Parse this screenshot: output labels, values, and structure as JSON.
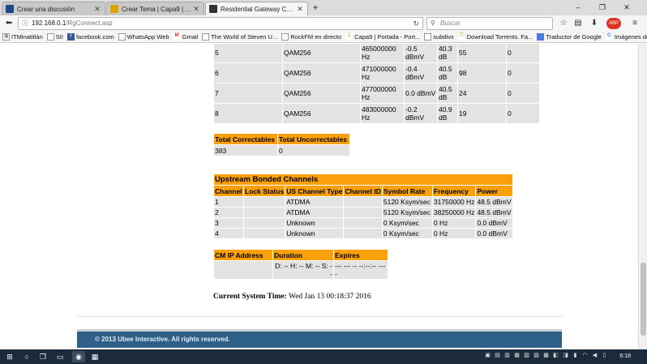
{
  "browser": {
    "tabs": [
      {
        "label": "Crear una discusión",
        "favicon_color": "#1a4a8a",
        "active": false
      },
      {
        "label": "Crear Tema | Capa9 | El Po...",
        "favicon_color": "#d9a400",
        "active": false
      },
      {
        "label": "Residential Gateway Confi...",
        "favicon_color": "#333333",
        "active": true
      }
    ],
    "new_tab": "+",
    "window_controls": {
      "minimize": "–",
      "maximize": "❐",
      "close": "✕"
    },
    "url_host": "192.168.0.1",
    "url_path": "/RgConnect.asp",
    "search_placeholder": "Buscar",
    "bookmarks": [
      {
        "label": "ITMinatitlán",
        "icon": "globe-icon"
      },
      {
        "label": "SII",
        "icon": "page-icon"
      },
      {
        "label": "facebook.com",
        "icon": "facebook-icon"
      },
      {
        "label": "WhatsApp Web",
        "icon": "page-icon"
      },
      {
        "label": "Gmail",
        "icon": "gmail-icon"
      },
      {
        "label": "The World of Steven U...",
        "icon": "page-icon"
      },
      {
        "label": "RockFM en directo",
        "icon": "page-icon"
      },
      {
        "label": "Capa9 | Portada - Port...",
        "icon": "capa9-icon"
      },
      {
        "label": "subdivx",
        "icon": "page-icon"
      },
      {
        "label": "Download Torrents. Fa...",
        "icon": "shield-icon"
      },
      {
        "label": "Traductor de Google",
        "icon": "translate-icon"
      },
      {
        "label": "Imágenes de Google",
        "icon": "google-icon"
      }
    ],
    "addon_badge": "ABP"
  },
  "downstream_rows": [
    {
      "channel": "5",
      "modulation": "QAM256",
      "frequency": "465000000 Hz",
      "power": "-0.5 dBmV",
      "snr": "40.3 dB",
      "correctables": "55",
      "uncorrectables": "0"
    },
    {
      "channel": "6",
      "modulation": "QAM256",
      "frequency": "471000000 Hz",
      "power": "-0.4 dBmV",
      "snr": "40.5 dB",
      "correctables": "98",
      "uncorrectables": "0"
    },
    {
      "channel": "7",
      "modulation": "QAM256",
      "frequency": "477000000 Hz",
      "power": "0.0 dBmV",
      "snr": "40.5 dB",
      "correctables": "24",
      "uncorrectables": "0"
    },
    {
      "channel": "8",
      "modulation": "QAM256",
      "frequency": "483000000 Hz",
      "power": "-0.2 dBmV",
      "snr": "40.9 dB",
      "correctables": "19",
      "uncorrectables": "0"
    }
  ],
  "errors": {
    "headers": [
      "Total Correctables",
      "Total Uncorrectables"
    ],
    "values": [
      "383",
      "0"
    ]
  },
  "upstream": {
    "title": "Upstream Bonded Channels",
    "headers": [
      "Channel",
      "Lock Status",
      "US Channel Type",
      "Channel ID",
      "Symbol Rate",
      "Frequency",
      "Power"
    ],
    "rows": [
      {
        "channel": "1",
        "lock": "",
        "type": "ATDMA",
        "id": "",
        "symbol_rate": "5120 Ksym/sec",
        "frequency": "31750000 Hz",
        "power": "48.5 dBmV"
      },
      {
        "channel": "2",
        "lock": "",
        "type": "ATDMA",
        "id": "",
        "symbol_rate": "5120 Ksym/sec",
        "frequency": "38250000 Hz",
        "power": "48.5 dBmV"
      },
      {
        "channel": "3",
        "lock": "",
        "type": "Unknown",
        "id": "",
        "symbol_rate": "0 Ksym/sec",
        "frequency": "0 Hz",
        "power": "0.0 dBmV"
      },
      {
        "channel": "4",
        "lock": "",
        "type": "Unknown",
        "id": "",
        "symbol_rate": "0 Ksym/sec",
        "frequency": "0 Hz",
        "power": "0.0 dBmV"
      }
    ]
  },
  "cm_info": {
    "headers": [
      "CM IP Address",
      "Duration",
      "Expires"
    ],
    "duration": "D: -- H: -- M: -- S: --",
    "expires": "--- --- -- --:--:-- ----"
  },
  "system_time": {
    "label": "Current System Time:",
    "value": "Wed Jan 13 00:18:37 2016"
  },
  "footer": {
    "text": "© 2013 Ubee Interactive. All rights reserved."
  },
  "taskbar": {
    "clock": "6:18"
  },
  "colors": {
    "header_orange": "#f9a00b",
    "cell_gray": "#e3e3e3",
    "footer_blue": "#2d5f87"
  }
}
